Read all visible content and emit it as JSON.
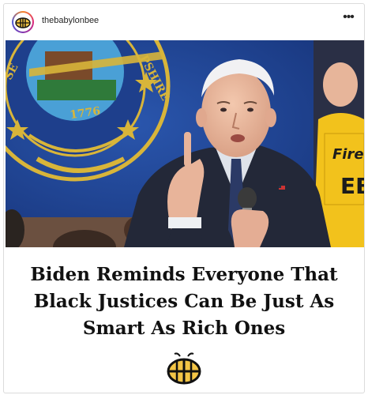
{
  "header": {
    "username": "thebabylonbee",
    "more_label": "•••"
  },
  "photo": {
    "seal_text_right": "PSHIRE",
    "seal_text_left": "SE",
    "seal_year": "1776",
    "sign_text_1": "Fire",
    "sign_text_2": "EB",
    "colors": {
      "backdrop": "#1e3f8c",
      "seal_gold": "#d8b53a",
      "sign_yellow": "#f2c21c",
      "suit": "#232838"
    }
  },
  "headline": {
    "line1": "Biden Reminds Everyone That",
    "line2": "Black Justices Can Be Just As",
    "line3": "Smart As Rich Ones"
  },
  "colors": {
    "text": "#111111",
    "logo_gold": "#f3c545",
    "logo_outline": "#111111"
  }
}
